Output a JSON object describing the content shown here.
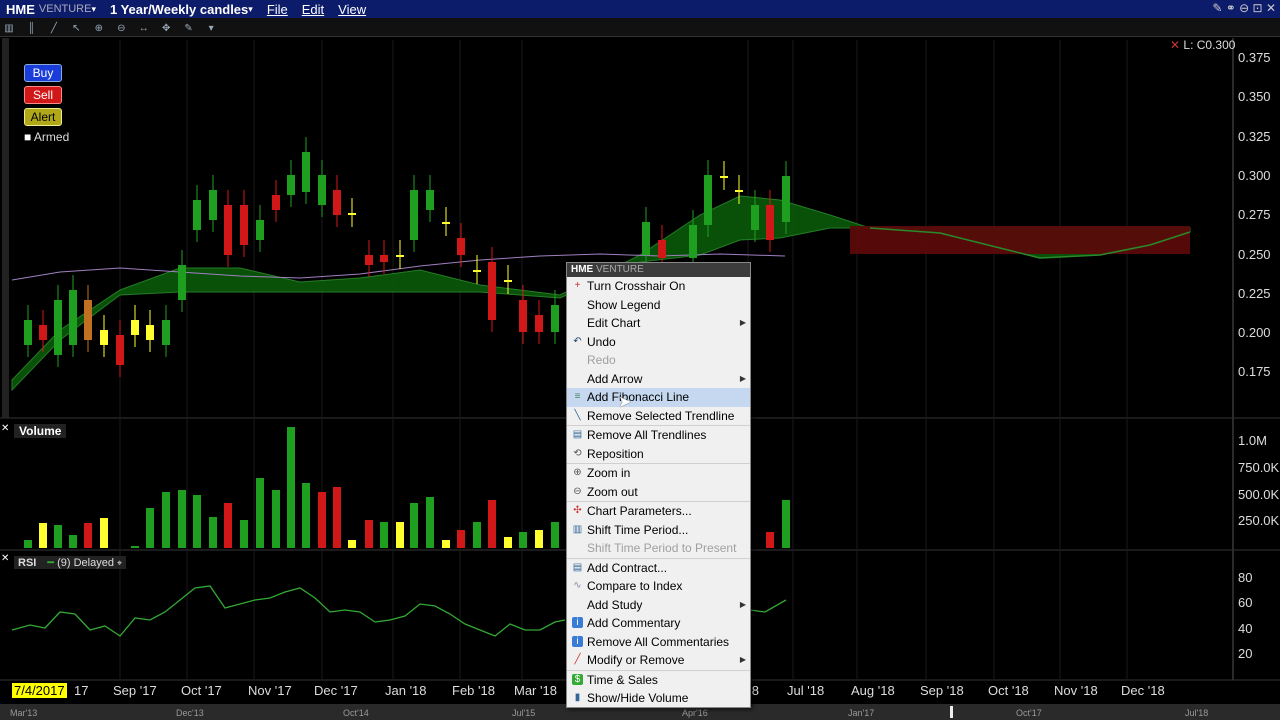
{
  "title": {
    "symbol": "HME",
    "exchange": "VENTURE",
    "period": "1 Year/Weekly candles",
    "menus": [
      "File",
      "Edit",
      "View"
    ]
  },
  "order_buttons": {
    "buy": "Buy",
    "sell": "Sell",
    "alert": "Alert",
    "armed": "Armed"
  },
  "price_panel": {
    "last_label": "L: C0.300",
    "y_ticks": [
      "0.375",
      "0.350",
      "0.325",
      "0.300",
      "0.275",
      "0.250",
      "0.225",
      "0.200",
      "0.175"
    ]
  },
  "volume_panel": {
    "title": "Volume",
    "y_ticks": [
      "1.0M",
      "750.0K",
      "500.0K",
      "250.0K"
    ]
  },
  "rsi_panel": {
    "title": "RSI",
    "legend": "(9) Delayed",
    "y_ticks": [
      "80",
      "60",
      "40",
      "20"
    ]
  },
  "x_axis": {
    "current_date": "7/4/2017",
    "labels": [
      "17",
      "Sep '17",
      "Oct '17",
      "Nov '17",
      "Dec '17",
      "Jan '18",
      "Feb '18",
      "Mar '18",
      "'18",
      "Jul '18",
      "Aug '18",
      "Sep '18",
      "Oct '18",
      "Nov '18",
      "Dec '18"
    ]
  },
  "overview_axis": [
    "Mar'13",
    "Dec'13",
    "Oct'14",
    "Jul'15",
    "Apr'16",
    "Jan'17",
    "Oct'17",
    "Jul'18"
  ],
  "context_menu": {
    "header_symbol": "HME",
    "header_exchange": "VENTURE",
    "items": [
      {
        "label": "Turn Crosshair On",
        "icon": "crosshair-icon",
        "glyph": "+",
        "color": "#c33"
      },
      {
        "label": "Show Legend",
        "icon": "",
        "glyph": ""
      },
      {
        "label": "Edit Chart",
        "icon": "",
        "glyph": "",
        "submenu": true
      },
      {
        "label": "Undo",
        "icon": "undo-icon",
        "glyph": "↶",
        "color": "#246"
      },
      {
        "label": "Redo",
        "icon": "redo-icon",
        "glyph": "",
        "disabled": true
      },
      {
        "label": "Add Arrow",
        "icon": "",
        "glyph": "",
        "submenu": true
      },
      {
        "label": "Add Fibonacci Line",
        "icon": "fibonacci-icon",
        "glyph": "≡",
        "color": "#486",
        "highlight": true
      },
      {
        "label": "Remove Selected Trendline",
        "icon": "trendline-icon",
        "glyph": "╲",
        "color": "#369"
      },
      {
        "label": "Remove All Trendlines",
        "icon": "trendlines-icon",
        "glyph": "▤",
        "color": "#369",
        "sep": true
      },
      {
        "label": "Reposition",
        "icon": "reposition-icon",
        "glyph": "⟲",
        "color": "#555"
      },
      {
        "label": "Zoom in",
        "icon": "zoom-in-icon",
        "glyph": "⊕",
        "color": "#555",
        "sep": true
      },
      {
        "label": "Zoom out",
        "icon": "zoom-out-icon",
        "glyph": "⊖",
        "color": "#555"
      },
      {
        "label": "Chart Parameters...",
        "icon": "parameters-icon",
        "glyph": "✣",
        "color": "#c33",
        "sep": true
      },
      {
        "label": "Shift Time Period...",
        "icon": "shift-icon",
        "glyph": "▥",
        "color": "#369"
      },
      {
        "label": "Shift Time Period to Present",
        "icon": "shift-present-icon",
        "glyph": "",
        "disabled": true
      },
      {
        "label": "Add Contract...",
        "icon": "contract-icon",
        "glyph": "▤",
        "color": "#369",
        "sep": true
      },
      {
        "label": "Compare to Index",
        "icon": "compare-icon",
        "glyph": "∿",
        "color": "#88a"
      },
      {
        "label": "Add Study",
        "icon": "",
        "glyph": "",
        "submenu": true
      },
      {
        "label": "Add Commentary",
        "icon": "commentary-icon",
        "glyph": "i",
        "color": "#fff",
        "bg": "#3a7bd5"
      },
      {
        "label": "Remove All Commentaries",
        "icon": "remove-commentary-icon",
        "glyph": "i",
        "color": "#fff",
        "bg": "#3a7bd5"
      },
      {
        "label": "Modify or Remove",
        "icon": "pencil-icon",
        "glyph": "╱",
        "color": "#c33",
        "submenu": true
      },
      {
        "label": "Time & Sales",
        "icon": "time-sales-icon",
        "glyph": "$",
        "color": "#fff",
        "bg": "#3a3",
        "sep": true
      },
      {
        "label": "Show/Hide Volume",
        "icon": "volume-icon",
        "glyph": "▮",
        "color": "#369"
      }
    ]
  },
  "colors": {
    "up": "#1f9f1f",
    "down": "#d01818",
    "doji": "#ffff30",
    "cloud_up": "#0a5a0a",
    "cloud_down": "#5a0a0a",
    "rsi_line": "#33aa33"
  }
}
